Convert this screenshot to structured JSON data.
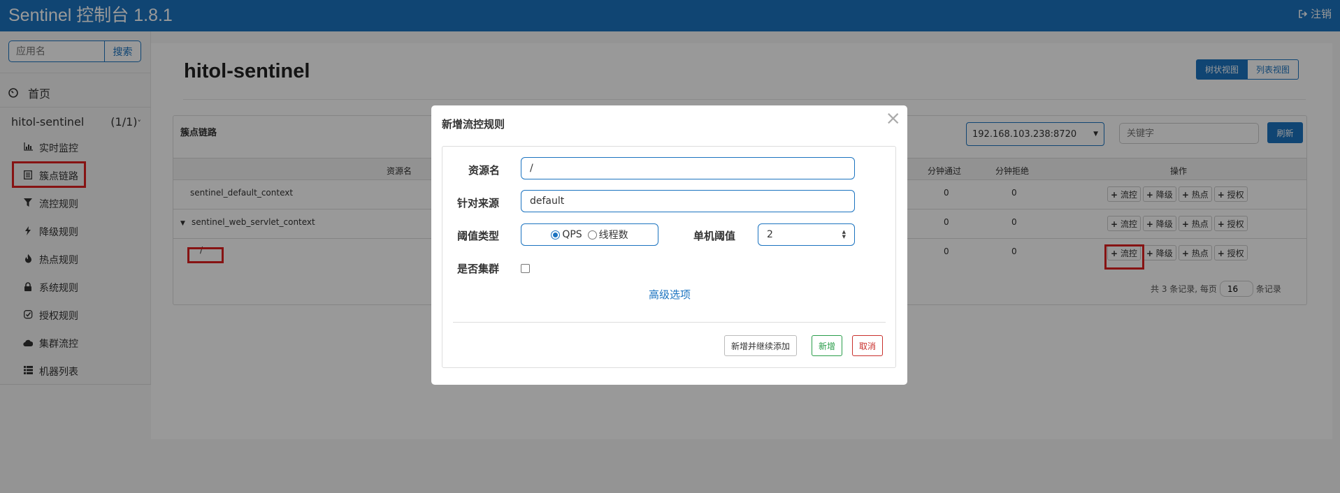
{
  "header": {
    "brand": "Sentinel 控制台 1.8.1",
    "logout_label": "注销",
    "color": "#1b73c0"
  },
  "sidebar": {
    "search_placeholder": "应用名",
    "search_button": "搜索",
    "home": "首页",
    "app_name": "hitol-sentinel",
    "app_count": "(1/1)",
    "items": [
      {
        "label": "实时监控",
        "icon": "bar-chart-icon"
      },
      {
        "label": "簇点链路",
        "icon": "list-icon"
      },
      {
        "label": "流控规则",
        "icon": "filter-icon"
      },
      {
        "label": "降级规则",
        "icon": "flash-icon"
      },
      {
        "label": "热点规则",
        "icon": "fire-icon"
      },
      {
        "label": "系统规则",
        "icon": "lock-icon"
      },
      {
        "label": "授权规则",
        "icon": "check-icon"
      },
      {
        "label": "集群流控",
        "icon": "cloud-icon"
      },
      {
        "label": "机器列表",
        "icon": "th-list-icon"
      }
    ]
  },
  "page": {
    "title": "hitol-sentinel",
    "tree_view": "树状视图",
    "list_view": "列表视图"
  },
  "panel": {
    "title": "簇点链路",
    "machine": "192.168.103.238:8720",
    "keyword_placeholder": "关键字",
    "refresh": "刷新",
    "columns": {
      "resource": "资源名",
      "pass": "分钟通过",
      "block": "分钟拒绝",
      "ops": "操作"
    },
    "rows": [
      {
        "name": "sentinel_default_context",
        "pass": "0",
        "block": "0"
      },
      {
        "name": "sentinel_web_servlet_context",
        "pass": "0",
        "block": "0"
      },
      {
        "name": "/",
        "pass": "0",
        "block": "0"
      }
    ],
    "ops": [
      "流控",
      "降级",
      "热点",
      "授权"
    ],
    "pager": {
      "prefix": "共 3 条记录, 每页",
      "page_size": "16",
      "suffix": "条记录"
    }
  },
  "modal": {
    "title": "新增流控规则",
    "close": "×",
    "resource_label": "资源名",
    "resource_value": "/",
    "source_label": "针对来源",
    "source_value": "default",
    "threshold_type_label": "阈值类型",
    "qps": "QPS",
    "threads": "线程数",
    "single_threshold_label": "单机阈值",
    "single_threshold_value": "2",
    "cluster_label": "是否集群",
    "advanced": "高级选项",
    "add_continue": "新增并继续添加",
    "add": "新增",
    "cancel": "取消"
  }
}
